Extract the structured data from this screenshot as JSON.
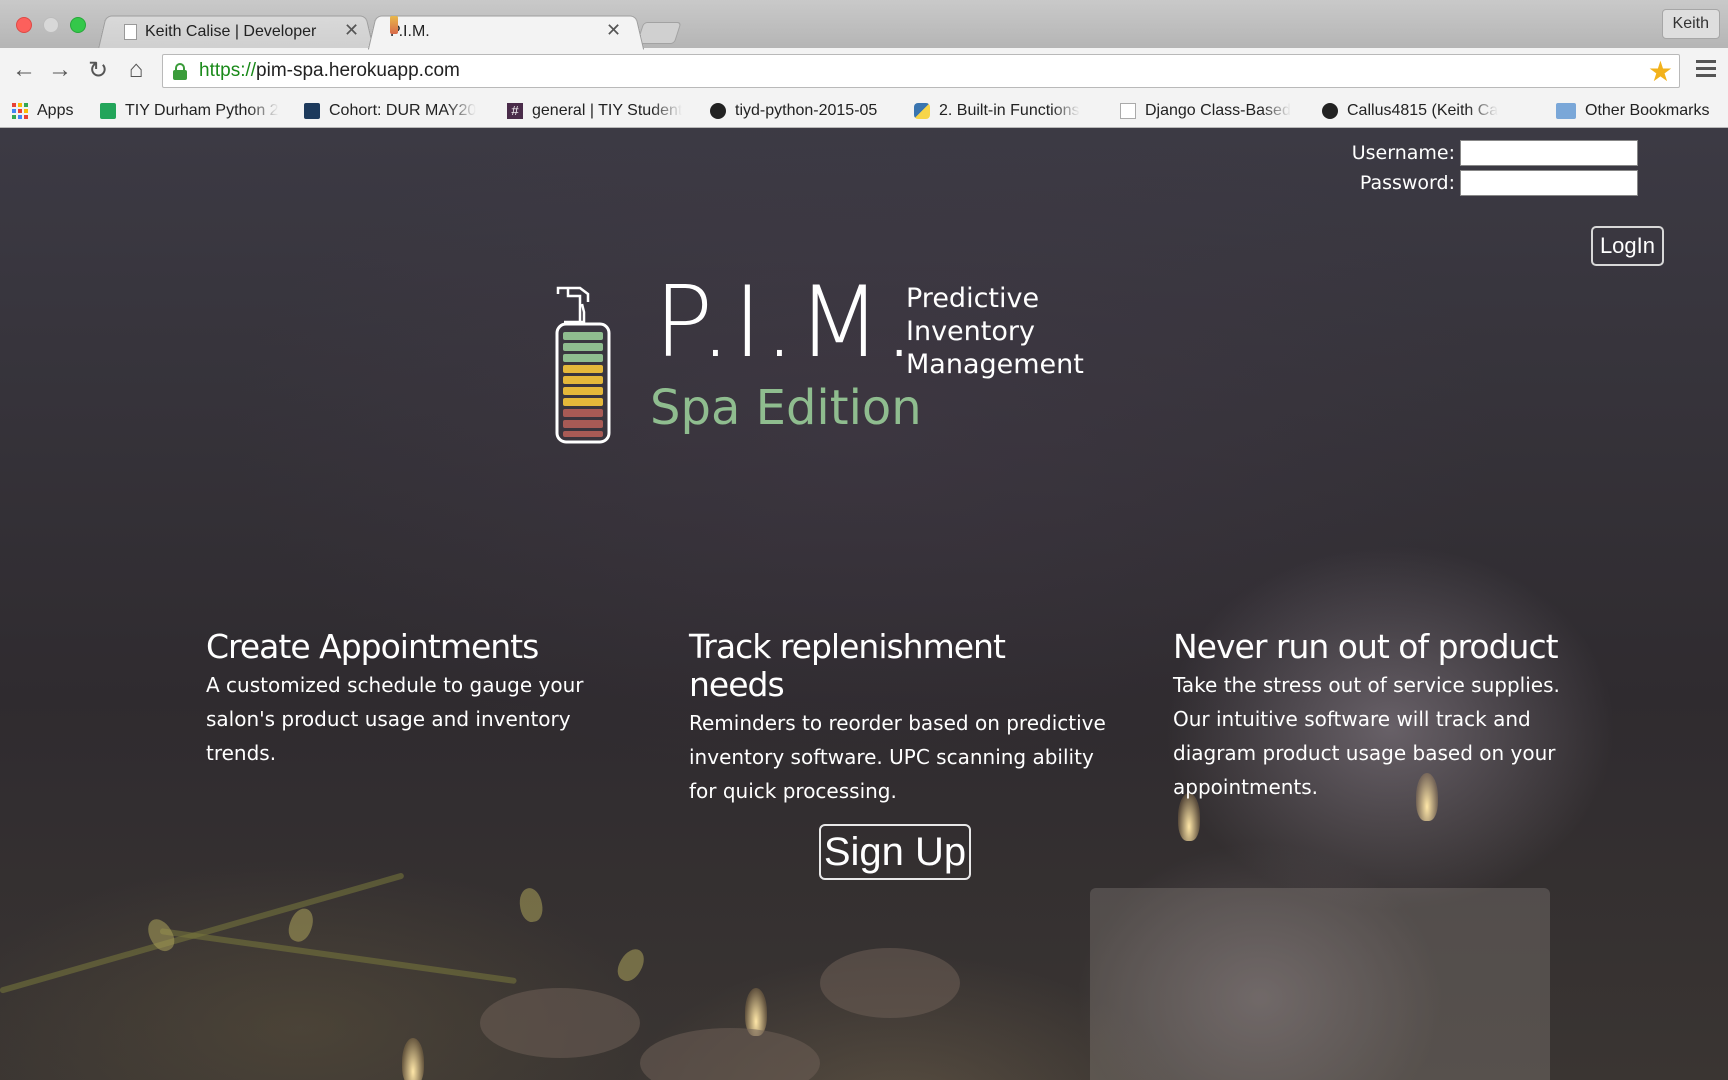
{
  "browser": {
    "tabs": [
      {
        "title": "Keith Calise | Developer",
        "active": false
      },
      {
        "title": "P.I.M.",
        "active": true
      }
    ],
    "profile_name": "Keith",
    "url_scheme": "https://",
    "url_host": "pim-spa.herokuapp.com",
    "bookmarks": [
      {
        "label": "Apps",
        "icon": "apps-grid-icon"
      },
      {
        "label": "TIY Durham Python 2",
        "icon": "sheets-icon"
      },
      {
        "label": "Cohort: DUR MAY20",
        "icon": "cohort-icon"
      },
      {
        "label": "general | TIY Student",
        "icon": "slack-hash-icon"
      },
      {
        "label": "tiyd-python-2015-05",
        "icon": "github-icon"
      },
      {
        "label": "2. Built-in Functions",
        "icon": "python-icon"
      },
      {
        "label": "Django Class-Based",
        "icon": "page-icon"
      },
      {
        "label": "Callus4815 (Keith Ca",
        "icon": "github-icon"
      },
      {
        "label": "Other Bookmarks",
        "icon": "folder-icon"
      }
    ]
  },
  "login": {
    "username_label": "Username:",
    "password_label": "Password:",
    "username_value": "",
    "password_value": "",
    "button_label": "LogIn"
  },
  "logo": {
    "acronym": "P.I.M.",
    "tagline_line1": "Predictive",
    "tagline_line2": "Inventory",
    "tagline_line3": "Management",
    "edition": "Spa Edition",
    "edition_color": "#8fbd8f"
  },
  "features": [
    {
      "title": "Create Appointments",
      "text": "A customized schedule to gauge your salon's product usage and inventory trends."
    },
    {
      "title": "Track replenishment needs",
      "text": "Reminders to reorder based on predictive inventory software. UPC scanning ability for quick processing."
    },
    {
      "title": "Never run out of product",
      "text": "Take the stress out of service supplies. Our intuitive software will track and diagram product usage based on your appointments."
    }
  ],
  "signup": {
    "label": "Sign Up"
  }
}
